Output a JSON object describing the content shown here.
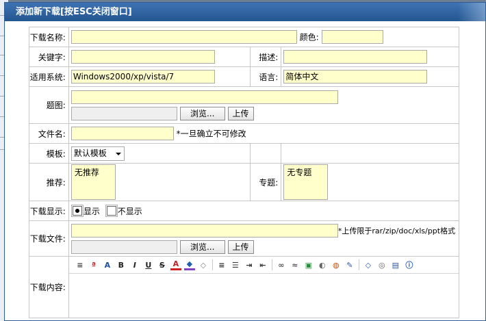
{
  "dialog": {
    "title": "添加新下载[按ESC关闭窗口]"
  },
  "labels": {
    "name": "下载名称:",
    "color": "颜色:",
    "keywords": "关键字:",
    "description": "描述:",
    "system": "适用系统:",
    "language": "语言:",
    "thumbnail": "题图:",
    "filename": "文件名:",
    "template": "模板:",
    "recommend": "推荐:",
    "topic": "专题:",
    "display": "下载显示:",
    "file": "下载文件:",
    "content": "下载内容:"
  },
  "values": {
    "name": "",
    "color": "",
    "keywords": "",
    "description": "",
    "system": "Windows2000/xp/vista/7",
    "language": "简体中文",
    "thumbnail_url": "",
    "filename": "",
    "template": "默认模板",
    "recommend": "无推荐",
    "topic": "无专题",
    "file_url": ""
  },
  "notes": {
    "filename": "*一旦确立不可修改",
    "file": "*上传限于rar/zip/doc/xls/ppt格式"
  },
  "buttons": {
    "browse": "浏览...",
    "upload": "上传"
  },
  "display_options": {
    "show": "显示",
    "hide": "不显示",
    "selected": "show"
  },
  "editor_toolbar": [
    "format-icon",
    "text-style-icon",
    "font-icon",
    "bold-icon",
    "italic-icon",
    "underline-icon",
    "strike-icon",
    "text-color-icon",
    "highlight-icon",
    "eraser-icon",
    "sep",
    "align-left-icon",
    "bullet-list-icon",
    "indent-icon",
    "outdent-icon",
    "sep",
    "link-icon",
    "unlink-icon",
    "image-icon",
    "media-icon",
    "flash-icon",
    "edit-icon",
    "sep",
    "source-icon",
    "preview-icon",
    "fullscreen-icon",
    "info-icon"
  ],
  "toolbar_glyphs": {
    "bold-icon": "B",
    "italic-icon": "I",
    "underline-icon": "U",
    "strike-icon": "S"
  },
  "colors": {
    "title_bg": "#2e5e93",
    "input_bg": "#ffffcc"
  }
}
